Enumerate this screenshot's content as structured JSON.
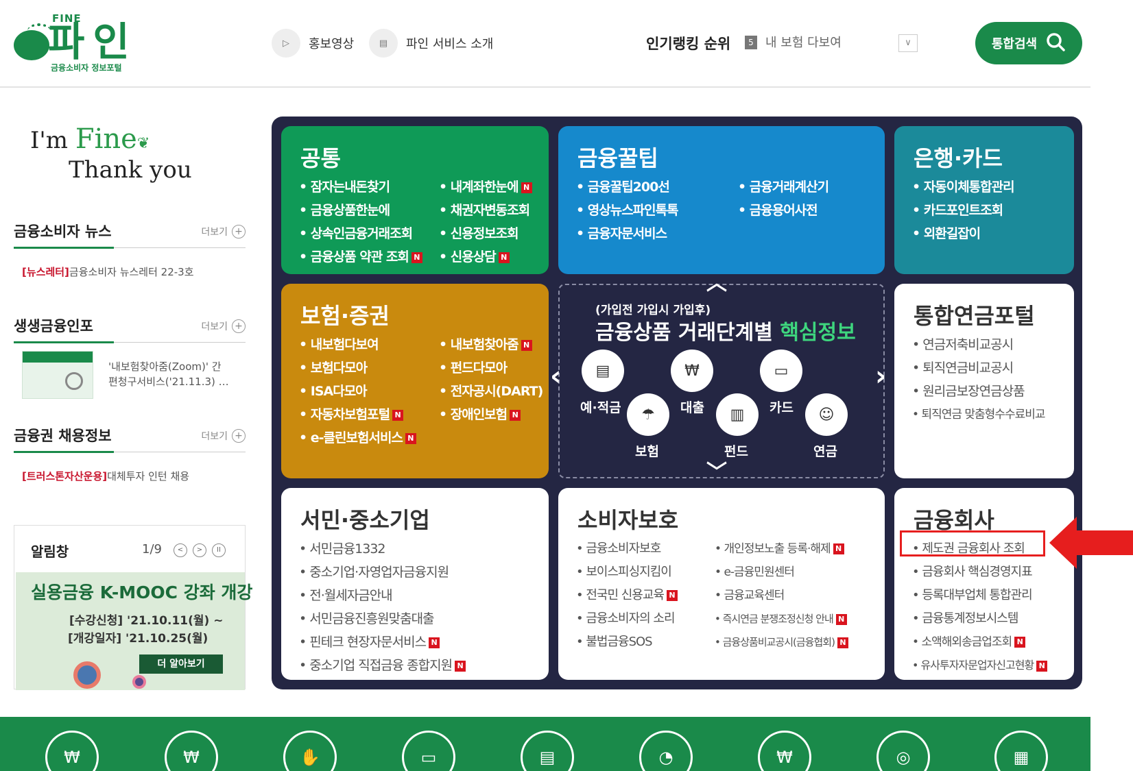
{
  "header": {
    "logo_small": "FINE",
    "logo_main": "파인",
    "logo_sub": "금융소비자 정보포털",
    "promo_video": "홍보영상",
    "service_intro": "파인 서비스 소개",
    "ranking_title": "인기랭킹 순위",
    "ranking_number": "5",
    "ranking_item": "내 보험 다보여",
    "search_label": "통합검색"
  },
  "left": {
    "greet_prefix": "I'm",
    "greet_fine": "Fine",
    "greet_line2": "Thank you",
    "more_label": "더보기",
    "news_title": "금융소비자 뉴스",
    "news_tag": "[뉴스레터]",
    "news_text": "금융소비자 뉴스레터 22-3호",
    "info_title": "생생금융인포",
    "info_line1": "'내보험찾아줌(Zoom)' 간",
    "info_line2": "편청구서비스('21.11.3) …",
    "jobs_title": "금융권 채용정보",
    "jobs_tag": "[트러스톤자산운용]",
    "jobs_text": "대체투자 인턴 채용",
    "notice_title": "알림창",
    "notice_count": "1/9",
    "banner_title": "실용금융 K-MOOC 강좌 개강",
    "banner_line1": "[수강신청] '21.10.11(월) ~",
    "banner_line2": "[개강일자] '21.10.25(월)",
    "banner_more": "더 알아보기"
  },
  "tiles": {
    "common": {
      "title": "공통",
      "items": [
        "잠자는내돈찾기",
        "내계좌한눈에",
        "금융상품한눈에",
        "채권자변동조회",
        "상속인금융거래조회",
        "신용정보조회",
        "금융상품 약관 조회",
        "신용상담"
      ]
    },
    "tips": {
      "title": "금융꿀팁",
      "items": [
        "금융꿀팁200선",
        "금융거래계산기",
        "영상뉴스파인톡톡",
        "금융용어사전",
        "금융자문서비스"
      ]
    },
    "bank": {
      "title": "은행·카드",
      "items": [
        "자동이체통합관리",
        "카드포인트조회",
        "외환길잡이"
      ]
    },
    "insurance": {
      "title": "보험·증권",
      "items": [
        "내보험다보여",
        "내보험찾아줌",
        "보험다모아",
        "펀드다모아",
        "ISA다모아",
        "전자공시(DART)",
        "자동차보험포털",
        "장애인보험",
        "e-클린보험서비스"
      ]
    },
    "pension": {
      "title": "통합연금포털",
      "items": [
        "연금저축비교공시",
        "퇴직연금비교공시",
        "원리금보장연금상품",
        "퇴직연금 맞춤형수수료비교"
      ]
    },
    "sme": {
      "title": "서민·중소기업",
      "items": [
        "서민금융1332",
        "중소기업·자영업자금융지원",
        "전·월세자금안내",
        "서민금융진흥원맞춤대출",
        "핀테크 현장자문서비스",
        "중소기업 직접금융 종합지원"
      ]
    },
    "consumer": {
      "title": "소비자보호",
      "items": [
        "금융소비자보호",
        "개인정보노출 등록·해제",
        "보이스피싱지킴이",
        "e-금융민원센터",
        "전국민 신용교육",
        "금융교육센터",
        "금융소비자의 소리",
        "즉시연금 분쟁조정신청 안내",
        "불법금융SOS",
        "금융상품비교공시(금융협회)"
      ]
    },
    "company": {
      "title": "금융회사",
      "items": [
        "제도권 금융회사 조회",
        "금융회사 핵심경영지표",
        "등록대부업체 통합관리",
        "금융통계정보시스템",
        "소액해외송금업조회",
        "유사투자자문업자신고현황"
      ]
    }
  },
  "center": {
    "subtitle": "(가입전 가입시 가입후)",
    "title_main": "금융상품 거래단계별",
    "title_highlight": "핵심정보",
    "savings": "예·적금",
    "loan": "대출",
    "card": "카드",
    "insurance": "보험",
    "fund": "펀드",
    "pension": "연금"
  },
  "badge_new": "N",
  "colors": {
    "brand": "#1a8a4a",
    "common": "#0f9a57",
    "tips": "#1689cc",
    "bank": "#1b8a9a",
    "insurance": "#c98a0e",
    "board": "#242643",
    "highlight": "#e61e1e"
  }
}
